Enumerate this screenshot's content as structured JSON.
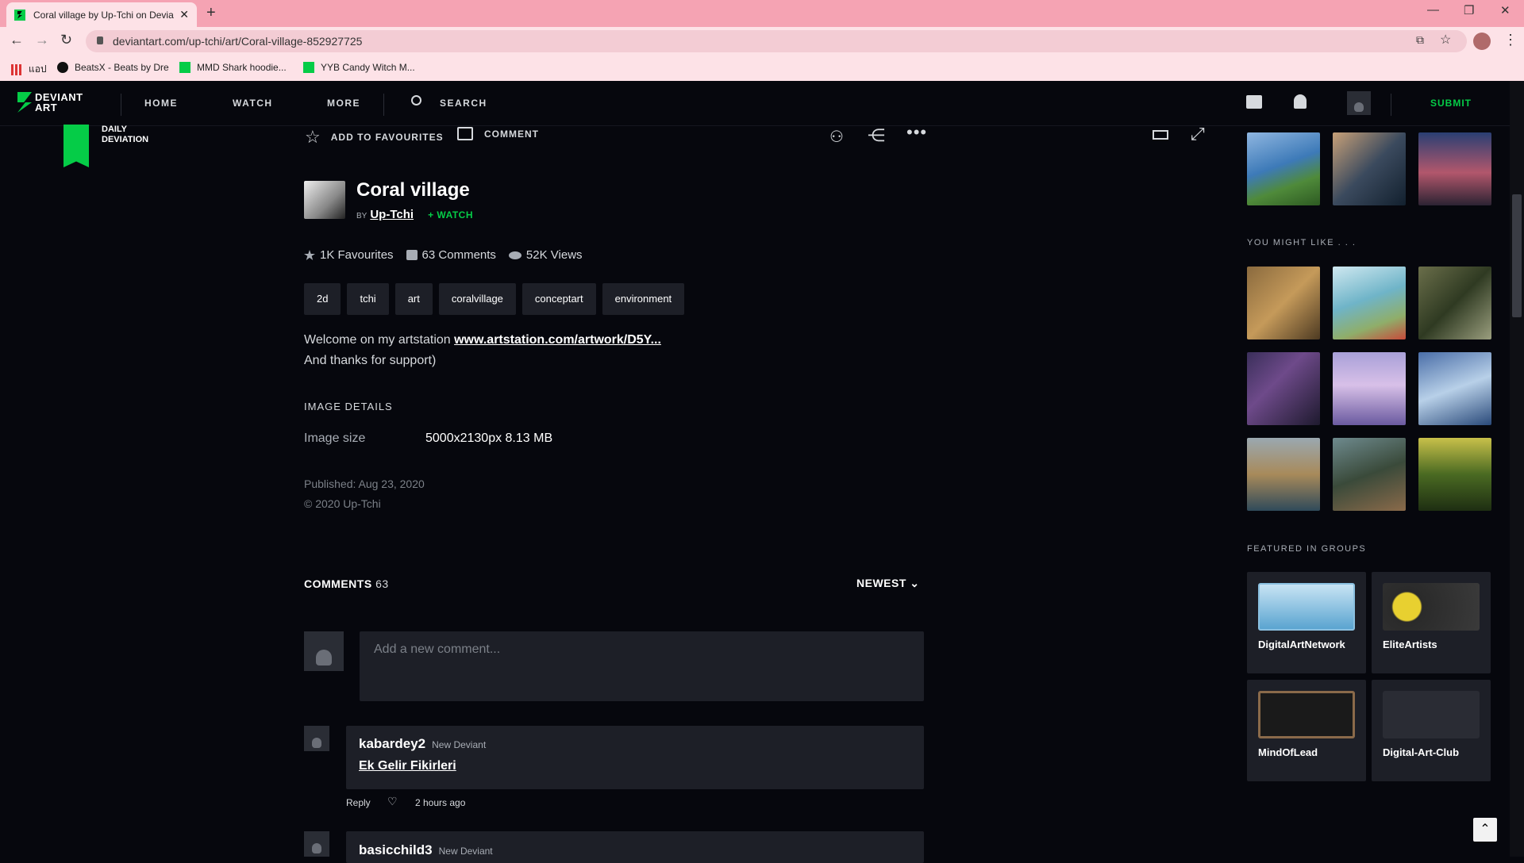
{
  "browser": {
    "tab_title": "Coral village by Up-Tchi on Devia",
    "url": "deviantart.com/up-tchi/art/Coral-village-852927725",
    "bookmarks": [
      "แอป",
      "BeatsX - Beats by Dre",
      "MMD Shark hoodie...",
      "YYB Candy Witch M..."
    ]
  },
  "header": {
    "logo_line1": "DEVIANT",
    "logo_line2": "ART",
    "nav": [
      "HOME",
      "WATCH",
      "MORE"
    ],
    "search": "SEARCH",
    "submit": "SUBMIT"
  },
  "toolbar": {
    "favourite": "ADD TO FAVOURITES",
    "comment": "COMMENT"
  },
  "daily_deviation": {
    "line1": "DAILY",
    "line2": "DEVIATION"
  },
  "deviation": {
    "title": "Coral village",
    "by": "BY",
    "author": "Up-Tchi",
    "watch": "+ WATCH",
    "stats": {
      "favourites": "1K Favourites",
      "comments": "63 Comments",
      "views": "52K Views"
    },
    "tags": [
      "2d",
      "tchi",
      "art",
      "coralvillage",
      "conceptart",
      "environment"
    ],
    "description_prefix": "Welcome on my artstation ",
    "description_link": "www.artstation.com/artwork/D5Y...",
    "description_line2": "And thanks for support)",
    "details_heading": "IMAGE DETAILS",
    "image_size_label": "Image size",
    "image_size_value": "5000x2130px 8.13 MB",
    "published": "Published: Aug 23, 2020",
    "copyright": "© 2020 Up-Tchi"
  },
  "comments": {
    "heading": "COMMENTS",
    "count": "63",
    "sort": "NEWEST",
    "placeholder": "Add a new comment...",
    "items": [
      {
        "user": "kabardey2",
        "badge": "New Deviant",
        "text": "Ek Gelir Fikirleri",
        "reply": "Reply",
        "time": "2 hours ago"
      },
      {
        "user": "basicchild3",
        "badge": "New Deviant"
      }
    ]
  },
  "rail": {
    "you_might_like": "YOU MIGHT LIKE . . .",
    "featured_in_groups": "FEATURED IN GROUPS",
    "groups": [
      "DigitalArtNetwork",
      "EliteArtists",
      "MindOfLead",
      "Digital-Art-Club"
    ]
  }
}
